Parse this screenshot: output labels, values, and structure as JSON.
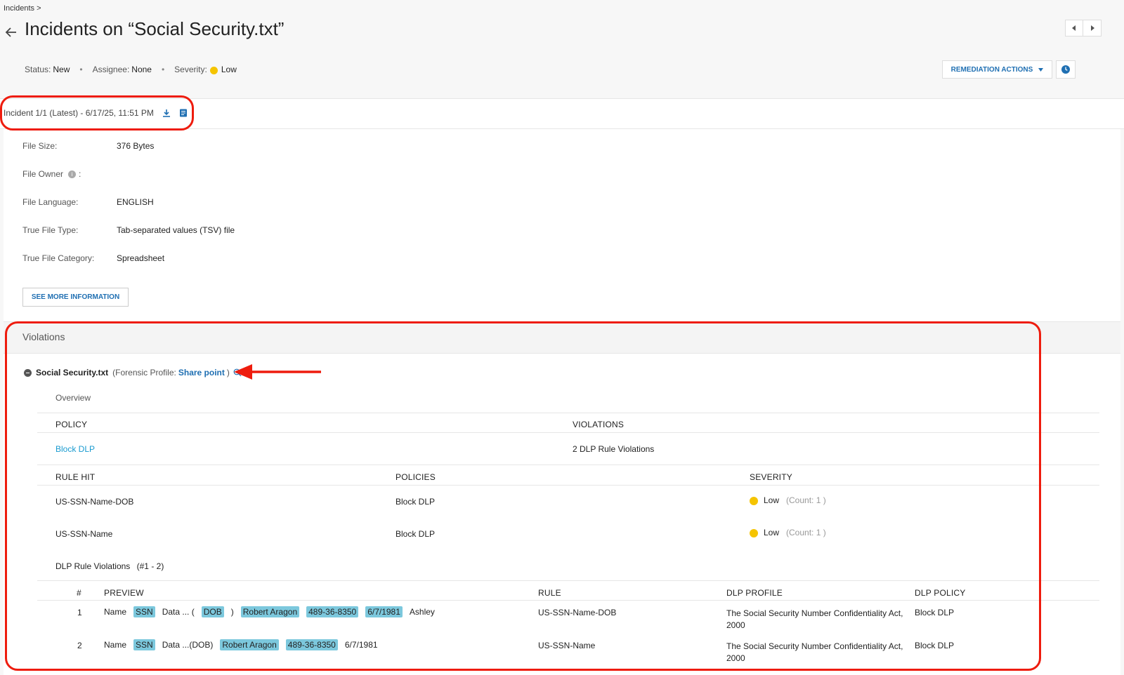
{
  "breadcrumb": "Incidents >",
  "page_title": "Incidents on “Social Security.txt”",
  "meta": {
    "status_label": "Status:",
    "status_value": "New",
    "assignee_label": "Assignee:",
    "assignee_value": "None",
    "severity_label": "Severity:",
    "severity_value": "Low",
    "separator": "•"
  },
  "remediation_label": "REMEDIATION ACTIONS",
  "incident_label": "Incident 1/1 (Latest) - 6/17/25, 11:51 PM",
  "file_info": [
    {
      "label": "File Size:",
      "value": "376 Bytes"
    },
    {
      "label": "File Owner",
      "value": ""
    },
    {
      "label": "File Language:",
      "value": "ENGLISH"
    },
    {
      "label": "True File Type:",
      "value": "Tab-separated values (TSV) file"
    },
    {
      "label": "True File Category:",
      "value": "Spreadsheet"
    }
  ],
  "file_owner_suffix": ":",
  "see_more": "SEE MORE INFORMATION",
  "violations_title": "Violations",
  "file_entry": {
    "name": "Social Security.txt",
    "profile_prefix": "(Forensic Profile:",
    "profile_link": "Share point",
    "profile_suffix": ")"
  },
  "overview": "Overview",
  "policy_table": {
    "headers": [
      "POLICY",
      "VIOLATIONS"
    ],
    "policy": "Block DLP",
    "violations": "2 DLP Rule Violations"
  },
  "rule_table": {
    "headers": [
      "RULE HIT",
      "POLICIES",
      "SEVERITY"
    ],
    "rows": [
      {
        "rule": "US-SSN-Name-DOB",
        "policy": "Block DLP",
        "severity": "Low",
        "count": "(Count: 1 )"
      },
      {
        "rule": "US-SSN-Name",
        "policy": "Block DLP",
        "severity": "Low",
        "count": "(Count: 1 )"
      }
    ]
  },
  "dlp_section": {
    "title": "DLP Rule Violations",
    "range": "(#1 - 2)"
  },
  "dlp_table": {
    "headers": [
      "#",
      "PREVIEW",
      "RULE",
      "DLP PROFILE",
      "DLP POLICY"
    ],
    "rows": [
      {
        "num": "1",
        "preview": [
          {
            "t": "Name",
            "hl": false
          },
          {
            "t": "SSN",
            "hl": true
          },
          {
            "t": "Data ... (",
            "hl": false
          },
          {
            "t": "DOB",
            "hl": true
          },
          {
            "t": ")",
            "hl": false
          },
          {
            "t": "Robert Aragon",
            "hl": true
          },
          {
            "t": "489-36-8350",
            "hl": true
          },
          {
            "t": "6/7/1981",
            "hl": true
          },
          {
            "t": "Ashley",
            "hl": false
          }
        ],
        "rule": "US-SSN-Name-DOB",
        "profile_l1": "The Social Security Number Confidentiality Act,",
        "profile_l2": "2000",
        "policy": "Block DLP"
      },
      {
        "num": "2",
        "preview": [
          {
            "t": "Name",
            "hl": false
          },
          {
            "t": "SSN",
            "hl": true
          },
          {
            "t": "Data ...(DOB)",
            "hl": false
          },
          {
            "t": "Robert Aragon",
            "hl": true
          },
          {
            "t": "489-36-8350",
            "hl": true
          },
          {
            "t": "6/7/1981",
            "hl": false
          }
        ],
        "rule": "US-SSN-Name",
        "profile_l1": "The Social Security Number Confidentiality Act,",
        "profile_l2": "2000",
        "policy": "Block DLP"
      }
    ]
  },
  "colors": {
    "accent": "#1f6fb2",
    "link": "#1a9bd0",
    "highlight": "#7cc8dd",
    "severity_low": "#f5c400",
    "annotation": "#ee1c0e"
  }
}
